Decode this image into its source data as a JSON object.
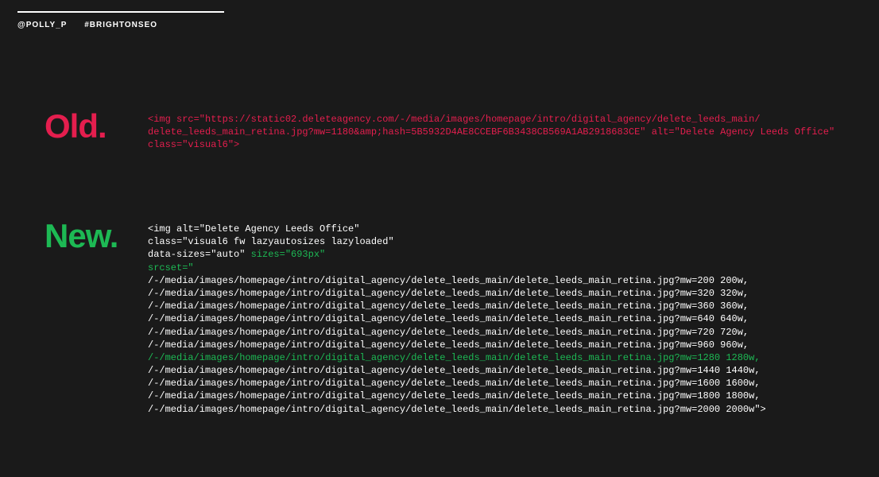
{
  "meta": {
    "handle": "@POLLY_P",
    "hashtag": "#BRIGHTONSEO"
  },
  "old": {
    "label": "Old.",
    "code_line1": "<img src=\"https://static02.deleteagency.com/-/media/images/homepage/intro/digital_agency/delete_leeds_main/",
    "code_line2": "delete_leeds_main_retina.jpg?mw=1180&amp;hash=5B5932D4AE8CCEBF6B3438CB569A1AB2918683CE\" alt=\"Delete Agency Leeds Office\"",
    "code_line3": "class=\"visual6\">"
  },
  "new": {
    "label": "New.",
    "l1": "<img alt=\"Delete Agency Leeds Office\"",
    "l2": "class=\"visual6 fw lazyautosizes lazyloaded\"",
    "l3a": "data-sizes=\"auto\" ",
    "l3b": "sizes=\"693px\"",
    "l4": "srcset=\"",
    "r200": "/-/media/images/homepage/intro/digital_agency/delete_leeds_main/delete_leeds_main_retina.jpg?mw=200 200w,",
    "r320": "/-/media/images/homepage/intro/digital_agency/delete_leeds_main/delete_leeds_main_retina.jpg?mw=320 320w,",
    "r360": "/-/media/images/homepage/intro/digital_agency/delete_leeds_main/delete_leeds_main_retina.jpg?mw=360 360w,",
    "r640": "/-/media/images/homepage/intro/digital_agency/delete_leeds_main/delete_leeds_main_retina.jpg?mw=640 640w,",
    "r720": "/-/media/images/homepage/intro/digital_agency/delete_leeds_main/delete_leeds_main_retina.jpg?mw=720 720w,",
    "r960": "/-/media/images/homepage/intro/digital_agency/delete_leeds_main/delete_leeds_main_retina.jpg?mw=960 960w,",
    "r1280": "/-/media/images/homepage/intro/digital_agency/delete_leeds_main/delete_leeds_main_retina.jpg?mw=1280 1280w,",
    "r1440": "/-/media/images/homepage/intro/digital_agency/delete_leeds_main/delete_leeds_main_retina.jpg?mw=1440 1440w,",
    "r1600": "/-/media/images/homepage/intro/digital_agency/delete_leeds_main/delete_leeds_main_retina.jpg?mw=1600 1600w,",
    "r1800": "/-/media/images/homepage/intro/digital_agency/delete_leeds_main/delete_leeds_main_retina.jpg?mw=1800 1800w,",
    "r2000": "/-/media/images/homepage/intro/digital_agency/delete_leeds_main/delete_leeds_main_retina.jpg?mw=2000 2000w\">"
  }
}
